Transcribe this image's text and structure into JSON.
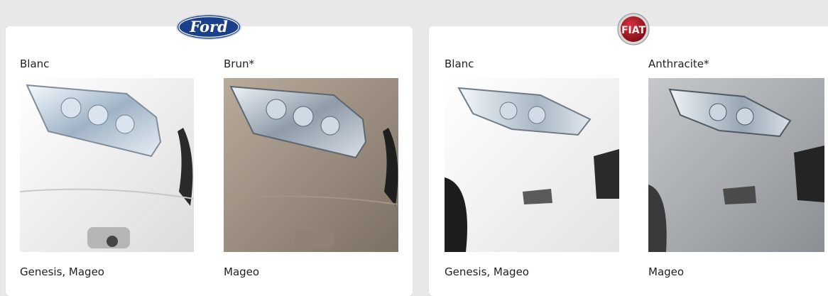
{
  "brands": [
    {
      "logo_text": "Ford",
      "variants": [
        {
          "color_name": "Blanc",
          "models": "Genesis, Mageo",
          "paint": "#f1f1ef"
        },
        {
          "color_name": "Brun*",
          "models": "Mageo",
          "paint": "#9c8f80"
        }
      ]
    },
    {
      "logo_text": "FIAT",
      "variants": [
        {
          "color_name": "Blanc",
          "models": "Genesis, Mageo",
          "paint": "#f3f3f3"
        },
        {
          "color_name": "Anthracite*",
          "models": "Mageo",
          "paint": "#a8abae"
        }
      ]
    }
  ],
  "colors": {
    "page_bg": "#e8e8e8",
    "card_bg": "#ffffff",
    "ford_blue": "#1a3f8c",
    "fiat_red": "#a8121d"
  }
}
